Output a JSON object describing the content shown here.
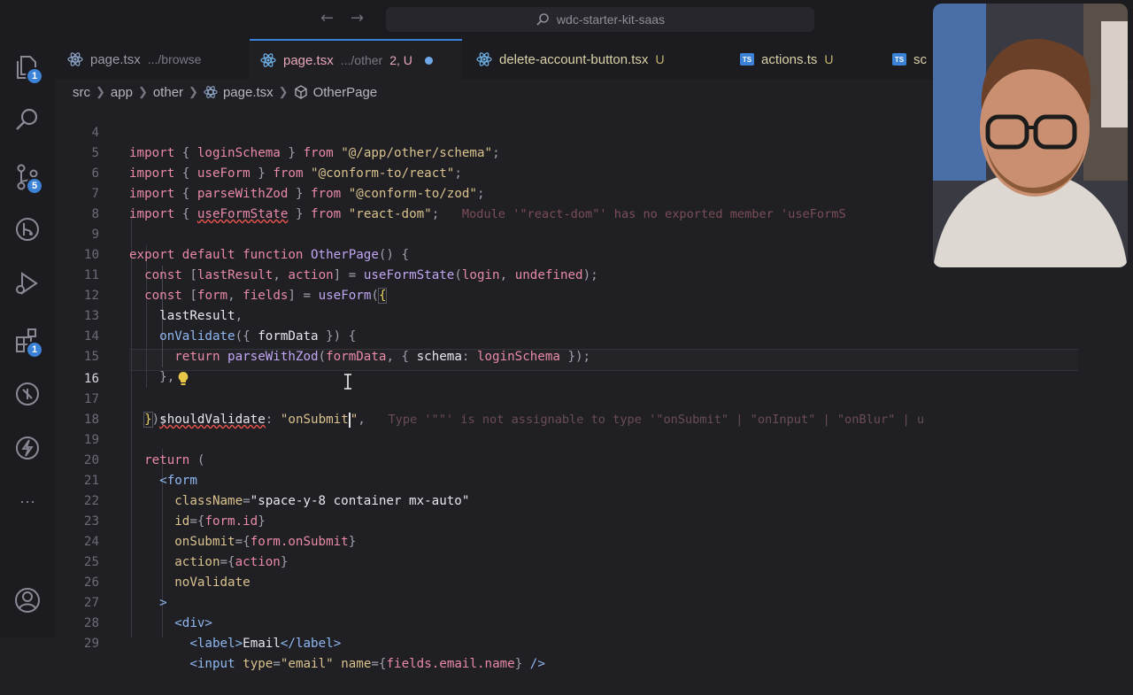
{
  "window": {
    "search_text": "wdc-starter-kit-saas",
    "back_label": "←",
    "forward_label": "→"
  },
  "activity_bar": {
    "explorer_badge": "1",
    "scm_badge": "5",
    "extensions_badge": "1",
    "more_label": "···"
  },
  "tabs": [
    {
      "name": "page.tsx",
      "path": ".../browse",
      "status": ""
    },
    {
      "name": "page.tsx",
      "path": ".../other",
      "status": "2, U"
    },
    {
      "name": "delete-account-button.tsx",
      "path": "",
      "status": "U"
    },
    {
      "name": "actions.ts",
      "path": "",
      "status": "U"
    },
    {
      "name": "sc",
      "path": "",
      "status": ""
    }
  ],
  "breadcrumb": [
    "src",
    "app",
    "other",
    "page.tsx",
    "OtherPage"
  ],
  "editor": {
    "current_line": "16",
    "line_numbers": [
      "4",
      "5",
      "6",
      "7",
      "8",
      "9",
      "10",
      "11",
      "12",
      "13",
      "14",
      "15",
      "16",
      "17",
      "18",
      "19",
      "20",
      "21",
      "22",
      "23",
      "24",
      "25",
      "26",
      "27",
      "28",
      "29"
    ],
    "code": {
      "l4_names": "loginSchema",
      "l4_src": "\"@/app/other/schema\"",
      "l5_names": "useForm",
      "l5_src": "\"@conform-to/react\"",
      "l6_names": "parseWithZod",
      "l6_src": "\"@conform-to/zod\"",
      "l7_names": "useFormState",
      "l7_src": "\"react-dom\"",
      "l7_diag": "Module '\"react-dom\"' has no exported member 'useFormS",
      "l9_fn": "OtherPage",
      "l10_a": "lastResult",
      "l10_b": "action",
      "l10_fn": "useFormState",
      "l10_c": "login",
      "l10_d": "undefined",
      "l11_a": "form",
      "l11_b": "fields",
      "l11_fn": "useForm",
      "l12": "lastResult",
      "l13_fn": "onValidate",
      "l13_arg": "formData",
      "l14_fn": "parseWithZod",
      "l14_a": "formData",
      "l14_key": "schema",
      "l14_val": "loginSchema",
      "l16_key": "shouldValidate",
      "l16_val": "\"onSubmit",
      "l16_diag": "Type '\"\"' is not assignable to type '\"onSubmit\" | \"onInput\" | \"onBlur\" | u",
      "l20_tag": "form",
      "l21_attr": "className",
      "l21_val": "\"space-y-8 container mx-auto\"",
      "l22_attr": "id",
      "l22_val": "form.id",
      "l23_attr": "onSubmit",
      "l23_val": "form.onSubmit",
      "l24_attr": "action",
      "l24_val": "action",
      "l25_attr": "noValidate",
      "l27_tag": "div",
      "l28_tag": "label",
      "l28_text": "Email",
      "l29_tag": "input",
      "l29_type_attr": "type",
      "l29_type_val": "\"email\"",
      "l29_name_attr": "name",
      "l29_name_val": "fields.email.name"
    }
  },
  "colors": {
    "keyword": "#e98aa6",
    "function": "#c1a6f2",
    "string": "#d9c28d",
    "tag": "#8fb8f0",
    "accent": "#3b82d6",
    "error": "#e5534b"
  }
}
